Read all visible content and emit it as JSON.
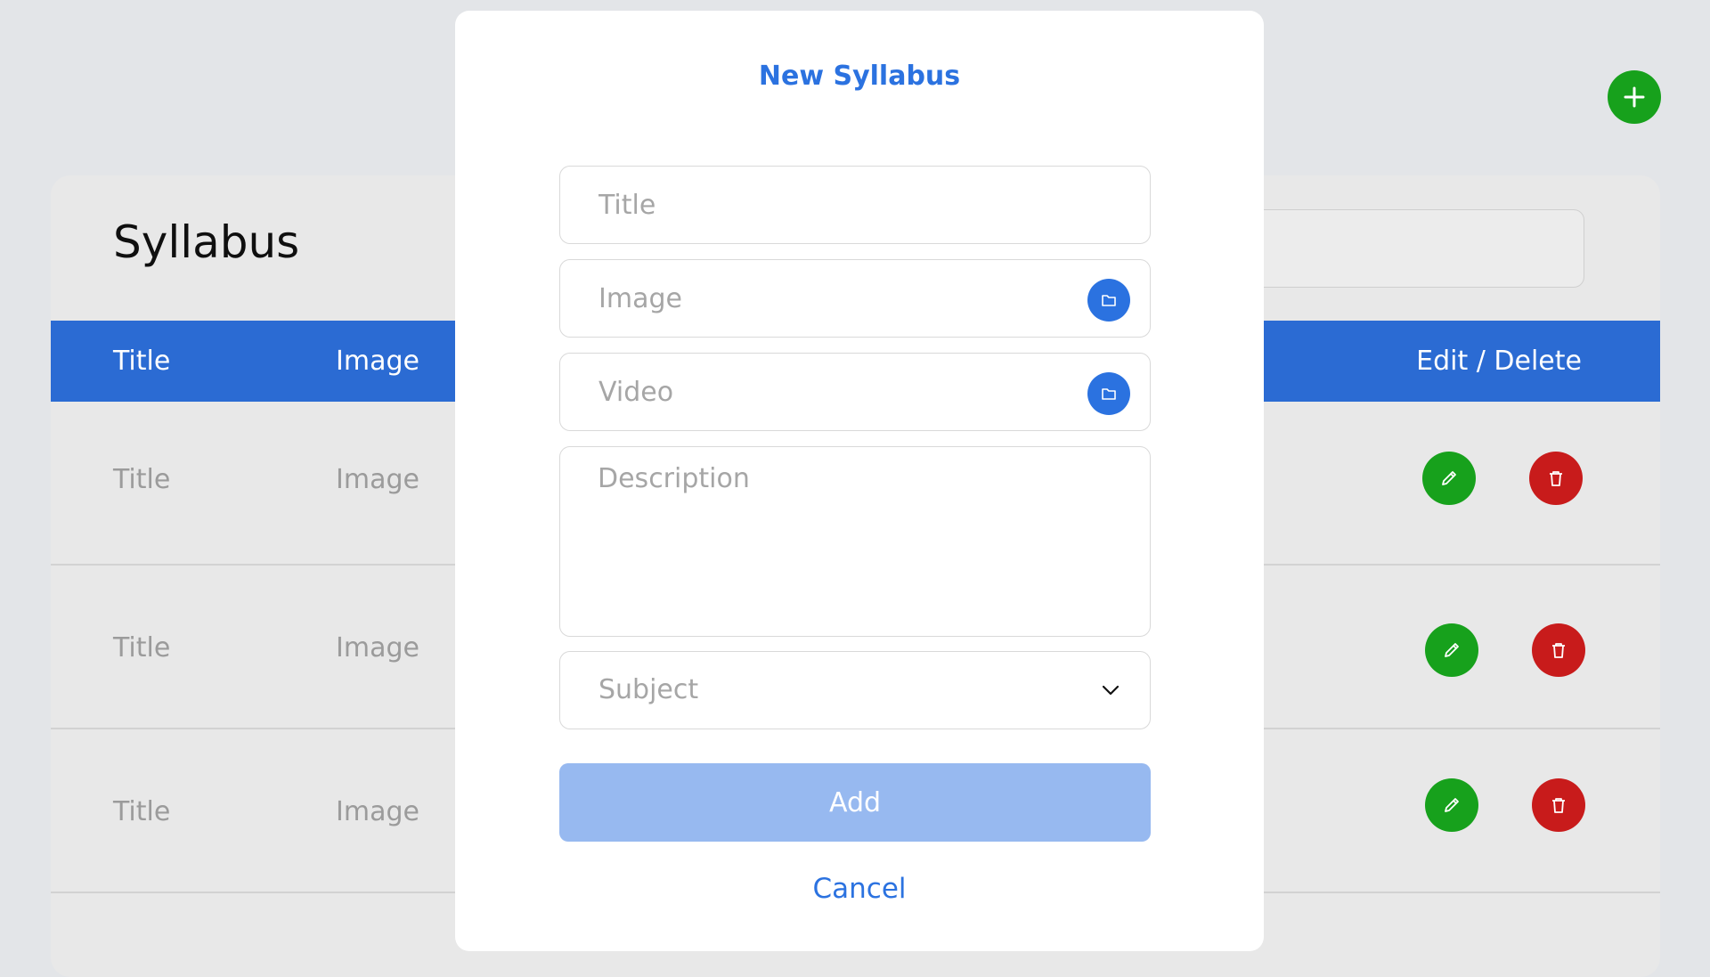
{
  "page": {
    "title": "Syllabus",
    "table": {
      "headers": {
        "title": "Title",
        "image": "Image",
        "actions": "Edit / Delete"
      },
      "rows": [
        {
          "title": "Title",
          "image": "Image"
        },
        {
          "title": "Title",
          "image": "Image"
        },
        {
          "title": "Title",
          "image": "Image"
        }
      ]
    }
  },
  "icons": {
    "fab": "plus-icon",
    "edit": "pencil-icon",
    "delete": "trash-icon",
    "folder": "folder-icon",
    "dropdown": "chevron-down-icon"
  },
  "colors": {
    "primary": "#2b72e0",
    "header": "#2b6bd3",
    "success": "#17a11c",
    "danger": "#c81b1b",
    "disabled_button": "#97b9f0"
  },
  "modal": {
    "title": "New Syllabus",
    "fields": {
      "title_placeholder": "Title",
      "image_placeholder": "Image",
      "video_placeholder": "Video",
      "description_placeholder": "Description",
      "subject_placeholder": "Subject"
    },
    "add_label": "Add",
    "cancel_label": "Cancel"
  }
}
